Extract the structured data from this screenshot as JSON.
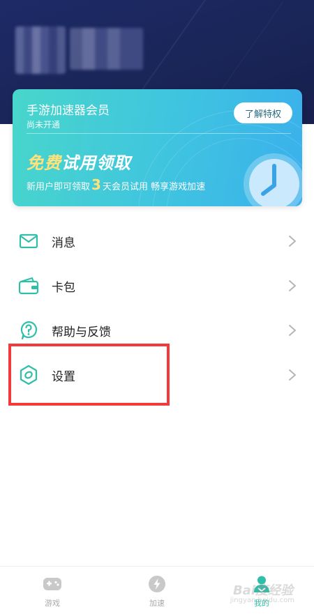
{
  "vip": {
    "title": "手游加速器会员",
    "status": "尚未开通",
    "button": "了解特权",
    "promo_part1": "免费",
    "promo_part2": "试用领取",
    "promo_sub_before": "新用户即可领取",
    "promo_days": "3",
    "promo_sub_after": "天会员试用 畅享游戏加速"
  },
  "menu": [
    {
      "label": "消息",
      "icon": "mail-icon"
    },
    {
      "label": "卡包",
      "icon": "wallet-icon"
    },
    {
      "label": "帮助与反馈",
      "icon": "help-icon"
    },
    {
      "label": "设置",
      "icon": "settings-icon"
    }
  ],
  "tabs": [
    {
      "label": "游戏",
      "icon": "gamepad-icon",
      "active": false
    },
    {
      "label": "加速",
      "icon": "lightning-icon",
      "active": false
    },
    {
      "label": "我的",
      "icon": "user-icon",
      "active": true
    }
  ],
  "watermark": {
    "main": "Bai度经验",
    "sub": "jingyan.baidu.com"
  },
  "colors": {
    "accent": "#2fbfa9",
    "header_bg": "#1d2a66",
    "highlight": "#f23a3a",
    "promo_gold": "#ffe27a"
  }
}
